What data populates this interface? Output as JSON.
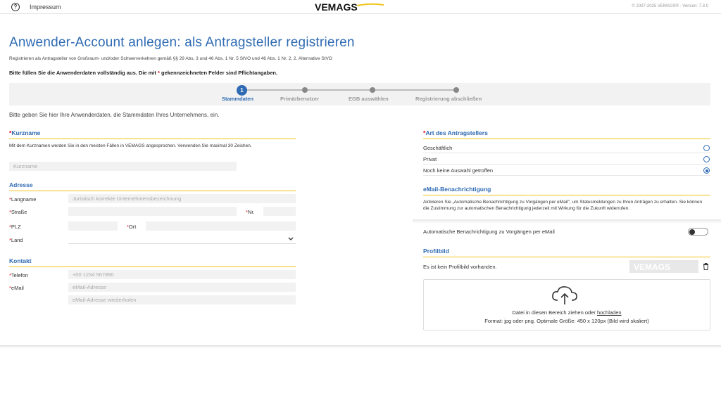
{
  "topbar": {
    "impressum": "Impressum",
    "logo_text": "VEMAGS",
    "version": "© 2007-2025 VEMAGS® - Version: 7.3.0"
  },
  "header": {
    "title": "Anwender-Account anlegen: als Antragsteller registrieren",
    "subtitle": "Registrieren als Antragsteller von Großraum- und/oder Schwerverkehren gemäß §§ 29 Abs. 3 und 46 Abs. 1 Nr. 5 StVO und 46 Abs. 1 Nr. 2, 2. Alternative StVO",
    "required_note_1": "Bitte füllen Sie die Anwenderdaten vollständig aus. Die mit",
    "required_note_star": "*",
    "required_note_2": "gekennzeichneten Felder sind Pflichtangaben."
  },
  "stepper": {
    "steps": [
      {
        "label": "Stammdaten",
        "number": "1"
      },
      {
        "label": "Primärbenutzer"
      },
      {
        "label": "EGB auswählen"
      },
      {
        "label": "Registrierung abschließen"
      }
    ]
  },
  "intro": "Bitte geben Sie hier Ihre Anwenderdaten, die Stammdaten Ihres Unternehmens, ein.",
  "kurzname": {
    "heading": "Kurzname",
    "help": "Mit dem Kurznamen werden Sie in den meisten Fällen in VEMAGS angesprochen. Verwenden Sie maximal 30 Zeichen.",
    "placeholder": "Kurzname"
  },
  "adresse": {
    "heading": "Adresse",
    "langname_label": "Langname",
    "langname_placeholder": "Juristisch korrekte Unternehmensbezeichnung",
    "strasse_label": "Straße",
    "nr_label": "Nr.",
    "plz_label": "PLZ",
    "ort_label": "Ort",
    "land_label": "Land"
  },
  "kontakt": {
    "heading": "Kontakt",
    "telefon_label": "Telefon",
    "telefon_placeholder": "+00 1234 567890",
    "email_label": "eMail",
    "email_placeholder": "eMail-Adresse",
    "email_repeat_placeholder": "eMail-Adresse wiederholen"
  },
  "art": {
    "heading": "Art des Antragstellers",
    "options": [
      "Geschäftlich",
      "Privat",
      "Noch keine Auswahl getroffen"
    ],
    "selected": "Noch keine Auswahl getroffen"
  },
  "benachrichtigung": {
    "heading": "eMail-Benachrichtigung",
    "help": "Aktivieren Sie „Automatische Benachrichtigung zu Vorgängen per eMail\", um Statusmeldungen zu Ihren Anträgen zu erhalten. Sie können die Zustimmung zur automatischen Benachrichtigung jederzeit mit Wirkung für die Zukunft widerrufen.",
    "toggle_label": "Automatische Benachrichtigung zu Vorgängen per eMail",
    "toggle_on": false
  },
  "profilbild": {
    "heading": "Profilbild",
    "status": "Es ist kein Profilbild vorhanden.",
    "drop_text": "Datei in diesen Bereich ziehen oder",
    "upload_link": "hochladen",
    "format_text": "Format: jpg oder png. Optimale Größe: 450 x 120px (Bild wird skaliert)"
  },
  "required_star": "*"
}
